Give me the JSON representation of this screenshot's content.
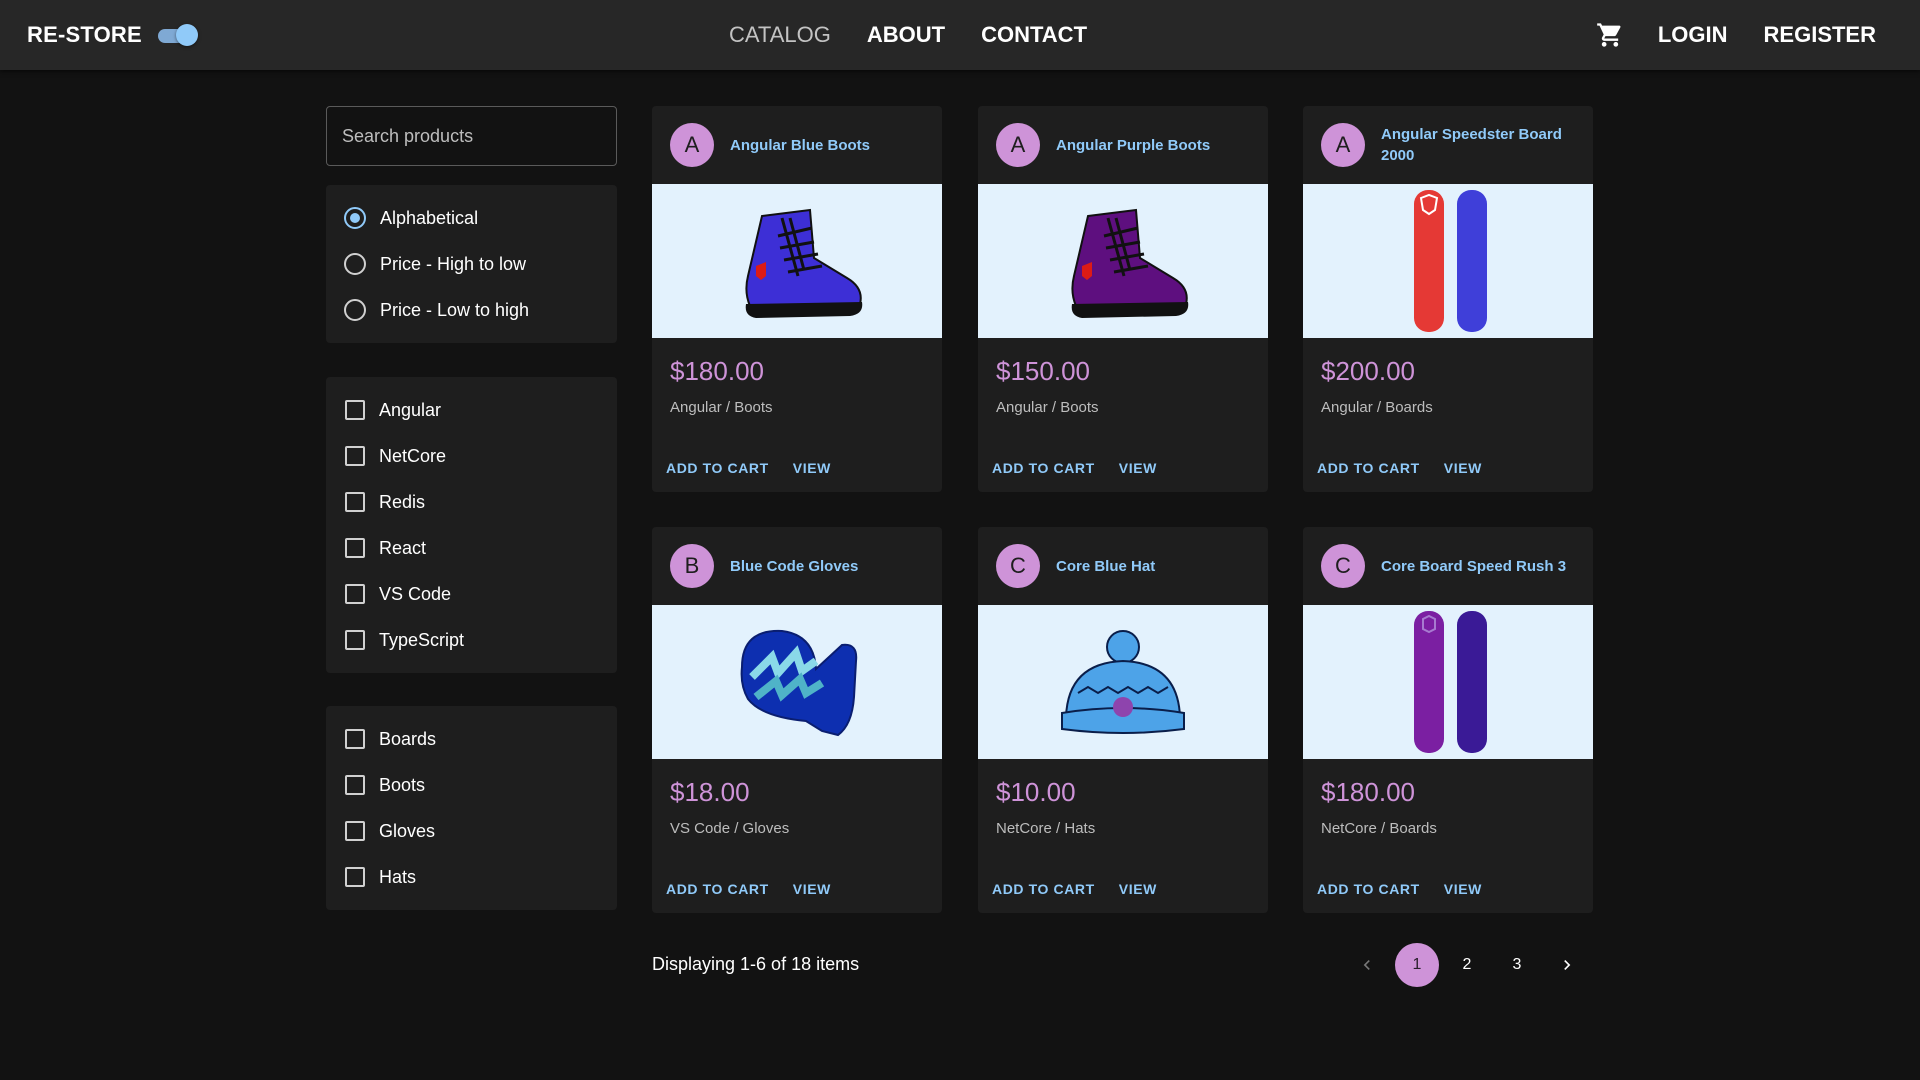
{
  "header": {
    "brand": "RE-STORE",
    "theme_toggle_on": true,
    "nav": [
      "CATALOG",
      "ABOUT",
      "CONTACT"
    ],
    "active_nav": "CATALOG",
    "right_nav": [
      "LOGIN",
      "REGISTER"
    ]
  },
  "sidebar": {
    "search_placeholder": "Search products",
    "sort_options": [
      "Alphabetical",
      "Price - High to low",
      "Price - Low to high"
    ],
    "selected_sort": "Alphabetical",
    "brands": [
      "Angular",
      "NetCore",
      "Redis",
      "React",
      "VS Code",
      "TypeScript"
    ],
    "types": [
      "Boards",
      "Boots",
      "Gloves",
      "Hats"
    ]
  },
  "products": [
    {
      "initial": "A",
      "name": "Angular Blue Boots",
      "price": "$180.00",
      "meta": "Angular / Boots",
      "image": "boot-blue"
    },
    {
      "initial": "A",
      "name": "Angular Purple Boots",
      "price": "$150.00",
      "meta": "Angular / Boots",
      "image": "boot-purple"
    },
    {
      "initial": "A",
      "name": "Angular Speedster Board 2000",
      "price": "$200.00",
      "meta": "Angular / Boards",
      "image": "board-red-blue"
    },
    {
      "initial": "B",
      "name": "Blue Code Gloves",
      "price": "$18.00",
      "meta": "VS Code / Gloves",
      "image": "glove-blue"
    },
    {
      "initial": "C",
      "name": "Core Blue Hat",
      "price": "$10.00",
      "meta": "NetCore / Hats",
      "image": "hat-blue"
    },
    {
      "initial": "C",
      "name": "Core Board Speed Rush 3",
      "price": "$180.00",
      "meta": "NetCore / Boards",
      "image": "board-purple"
    }
  ],
  "card_actions": {
    "add": "ADD TO CART",
    "view": "VIEW"
  },
  "footer": {
    "display_text": "Displaying 1-6 of 18 items",
    "pages": [
      "1",
      "2",
      "3"
    ],
    "current_page": "1"
  },
  "colors": {
    "accent": "#90caf9",
    "secondary": "#ce93d8",
    "background": "#121212",
    "paper": "#1e1e1e"
  }
}
